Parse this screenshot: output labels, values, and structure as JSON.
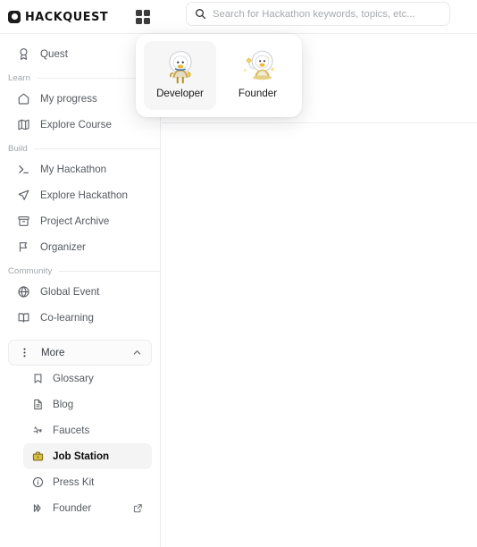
{
  "header": {
    "logo_text": "HACKQUEST",
    "logo_icon": "hackquest-logo-mark",
    "grid_icon": "grid-apps-icon",
    "search": {
      "placeholder": "Search for Hackathon keywords, topics, etc...",
      "value": "",
      "icon": "search-icon"
    }
  },
  "role_panel": {
    "options": [
      {
        "label": "Developer",
        "icon": "developer-duck-astronaut-illustration",
        "selected": true
      },
      {
        "label": "Founder",
        "icon": "founder-duck-astronaut-illustration",
        "selected": false
      }
    ]
  },
  "sidebar": {
    "top_items": [
      {
        "label": "Quest",
        "icon": "award-medal-icon"
      }
    ],
    "sections": [
      {
        "title": "Learn",
        "items": [
          {
            "label": "My progress",
            "icon": "home-icon"
          },
          {
            "label": "Explore Course",
            "icon": "map-icon"
          }
        ]
      },
      {
        "title": "Build",
        "items": [
          {
            "label": "My Hackathon",
            "icon": "terminal-icon"
          },
          {
            "label": "Explore Hackathon",
            "icon": "navigation-send-icon"
          },
          {
            "label": "Project Archive",
            "icon": "archive-box-icon"
          },
          {
            "label": "Organizer",
            "icon": "flag-icon"
          }
        ]
      },
      {
        "title": "Community",
        "items": [
          {
            "label": "Global Event",
            "icon": "globe-icon"
          },
          {
            "label": "Co-learning",
            "icon": "open-book-icon"
          }
        ]
      }
    ],
    "more": {
      "label": "More",
      "icon": "vertical-dots-icon",
      "chevron": "chevron-up-icon",
      "expanded": true,
      "items": [
        {
          "label": "Glossary",
          "icon": "bookmark-icon",
          "active": false,
          "external": false
        },
        {
          "label": "Blog",
          "icon": "document-text-icon",
          "active": false,
          "external": false
        },
        {
          "label": "Faucets",
          "icon": "faucet-icon",
          "active": false,
          "external": false
        },
        {
          "label": "Job Station",
          "icon": "briefcase-icon",
          "active": true,
          "external": false
        },
        {
          "label": "Press Kit",
          "icon": "info-circle-icon",
          "active": false,
          "external": false
        },
        {
          "label": "Founder",
          "icon": "double-chevron-right-icon",
          "active": false,
          "external": true,
          "external_icon": "external-link-icon"
        }
      ]
    }
  },
  "colors": {
    "accent_gold": "#B89B2B",
    "text_primary": "#0c0c0c",
    "text_muted": "#55595f",
    "section_label": "#a0a4aa",
    "border": "#ededef",
    "active_bg": "#f4f4f5"
  }
}
